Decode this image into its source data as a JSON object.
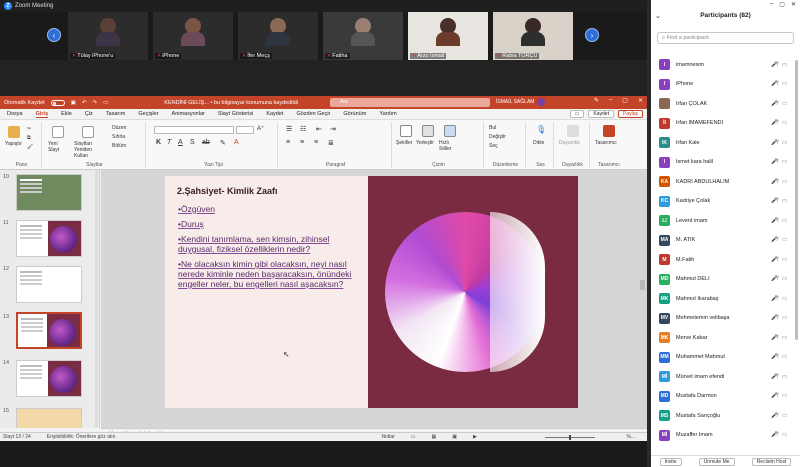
{
  "zoom": {
    "window_title": "Zoom Meeting",
    "gallery_tiles": [
      {
        "name": "Tülay iPhone'u"
      },
      {
        "name": "iPhone"
      },
      {
        "name": "İfer Meçş"
      },
      {
        "name": "Fatiha"
      },
      {
        "name": "Arzu İsmail"
      },
      {
        "name": "Rabia TORÇU"
      }
    ]
  },
  "ppt": {
    "autosave_label": "Otomatik Kaydet",
    "doc_title": "KENDİNİ GELİŞ... • bu bilgisayar konumuna kaydedildi",
    "search_placeholder": "Ara",
    "user_name": "İSMAİL SAĞLAM",
    "menu": [
      "Dosya",
      "Giriş",
      "Ekle",
      "Çiz",
      "Tasarım",
      "Geçişler",
      "Animasyonlar",
      "Slayt Gösterisi",
      "Kaydet",
      "Gözden Geçir",
      "Görünüm",
      "Yardım"
    ],
    "menu_active": "Giriş",
    "record_btn": "Kaydet",
    "share_btn": "Paylaş",
    "ribbon": {
      "paste": "Yapıştır",
      "new_slide": "Yeni Slayt",
      "reuse": "Slaytları Yeniden Kullan",
      "layout": "Düzen",
      "reset": "Sıfırla",
      "section": "Bölüm",
      "groups": {
        "clipboard": "Pano",
        "slides": "Slaytlar",
        "font": "Yazı Tipi",
        "paragraph": "Paragraf",
        "drawing": "Çizim",
        "editing": "Düzenleme",
        "voice": "Ses",
        "sensitivity": "Duyarlılık",
        "designer": "Tasarımcı"
      },
      "shapes": "Şekiller",
      "arrange": "Yerleştir",
      "quick_styles": "Hızlı Stiller",
      "find": "Bul",
      "replace": "Değiştir",
      "select": "Seç",
      "dictate": "Dikte",
      "sensitivity_btn": "Duyarlılık",
      "designer_btn": "Tasarımcı"
    },
    "thumb_numbers": [
      "10",
      "11",
      "12",
      "13",
      "14",
      "15"
    ],
    "slide": {
      "title": "2.Şahsiyet- Kimlik Zaafı",
      "bullets": [
        "•Özgüven",
        "•Duruş",
        "•Kendini tanımlama, sen kimsin, zihinsel duygusal, fiziksel özelliklerin nedir?",
        "•Ne olacaksın kimin gibi olacaksın, neyi nasıl nerede kiminle neden başaracaksın, önündeki engeller neler, bu engelleri nasıl aşacaksın?"
      ]
    },
    "notes_placeholder": "Not eklemek için tıklayın",
    "status": {
      "slide_of": "Slayt 13 / 24",
      "accessibility": "Erişilebilirlik: Önerilere göz atın",
      "notes": "Notlar",
      "zoom": "%..."
    }
  },
  "participants": {
    "title": "Participants (82)",
    "search_placeholder": "Find a participant",
    "list": [
      {
        "initials": "I",
        "name": "imamnesim",
        "color": "#8a3fbf"
      },
      {
        "initials": "I",
        "name": "iPhone",
        "color": "#8a3fbf"
      },
      {
        "initials": "",
        "name": "İrfan ÇOLAK",
        "color": "#8a6a55"
      },
      {
        "initials": "İI",
        "name": "İrfan İMAMEFENDİ",
        "color": "#c0392b"
      },
      {
        "initials": "IK",
        "name": "İrfan Kale",
        "color": "#2d8c8c"
      },
      {
        "initials": "I",
        "name": "İsmet kara halil",
        "color": "#8a3fbf"
      },
      {
        "initials": "KA",
        "name": "KADRİ ABDULHALİM",
        "color": "#d35400"
      },
      {
        "initials": "KC",
        "name": "Kadriye Çolak",
        "color": "#2d9cdb"
      },
      {
        "initials": "LI",
        "name": "Levent imam",
        "color": "#27ae60"
      },
      {
        "initials": "MA",
        "name": "M. ATİK",
        "color": "#34495e"
      },
      {
        "initials": "M",
        "name": "M.Fatih",
        "color": "#c0392b"
      },
      {
        "initials": "MD",
        "name": "Mahmut DELİ",
        "color": "#27ae60"
      },
      {
        "initials": "MK",
        "name": "Mahmut Ikarabaş",
        "color": "#16a085"
      },
      {
        "initials": "MV",
        "name": "Mehmetemin velibaşa",
        "color": "#34495e"
      },
      {
        "initials": "MK",
        "name": "Merve Kabar",
        "color": "#e67e22"
      },
      {
        "initials": "MM",
        "name": "Muhammet Mahmut",
        "color": "#2d6fd6"
      },
      {
        "initials": "Mİ",
        "name": "Mürvet imam efendi",
        "color": "#2d9cdb"
      },
      {
        "initials": "MD",
        "name": "Mustafa Darmon",
        "color": "#2d6fd6"
      },
      {
        "initials": "MS",
        "name": "Mustafa Sarıçoğlu",
        "color": "#16a085"
      },
      {
        "initials": "Mİ",
        "name": "Muzaffer İmam",
        "color": "#8a3fbf"
      }
    ],
    "buttons": [
      "Invite",
      "Unmute Me",
      "Reclaim Host"
    ]
  }
}
